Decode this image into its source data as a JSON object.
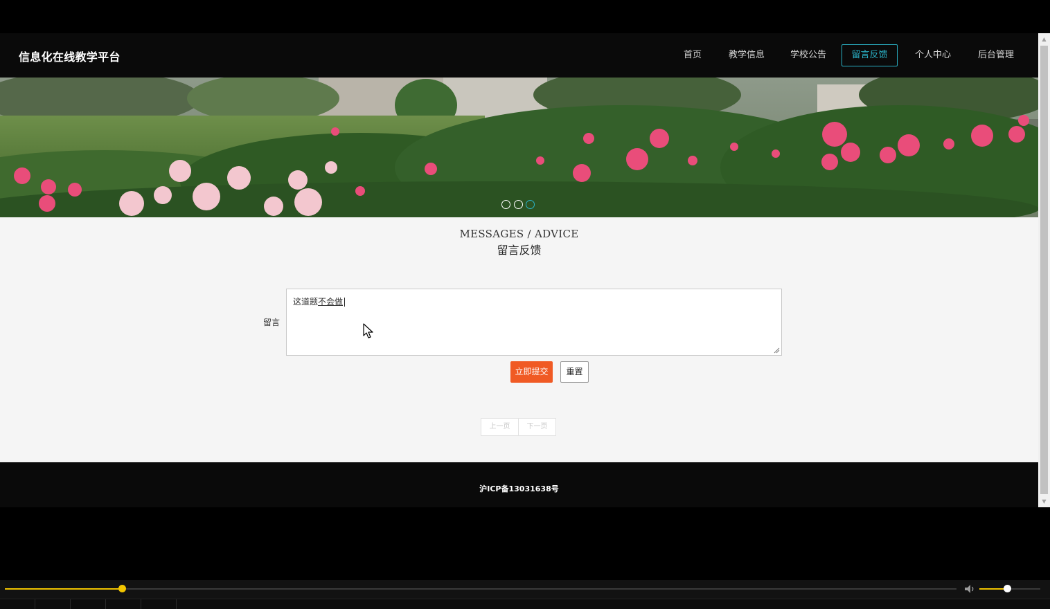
{
  "app": {
    "brand": "信息化在线教学平台"
  },
  "nav": {
    "items": [
      {
        "label": "首页",
        "active": false
      },
      {
        "label": "教学信息",
        "active": false
      },
      {
        "label": "学校公告",
        "active": false
      },
      {
        "label": "留言反馈",
        "active": true
      },
      {
        "label": "个人中心",
        "active": false
      },
      {
        "label": "后台管理",
        "active": false
      }
    ],
    "accent": "#2bb3c8"
  },
  "banner": {
    "slides": 3,
    "active_slide": 3
  },
  "section": {
    "title_en": "MESSAGES / ADVICE",
    "title_cn": "留言反馈"
  },
  "form": {
    "label": "留言",
    "message_value_plain": "这道题",
    "message_value_underlined": "不会做",
    "submit_label": "立即提交",
    "reset_label": "重置",
    "submit_color": "#f05a24"
  },
  "pager": {
    "prev_label": "上一页",
    "next_label": "下一页"
  },
  "footer": {
    "icp": "沪ICP备13031638号"
  },
  "player": {
    "progress": 0.123,
    "volume": 0.45,
    "accent": "#f2c500"
  }
}
